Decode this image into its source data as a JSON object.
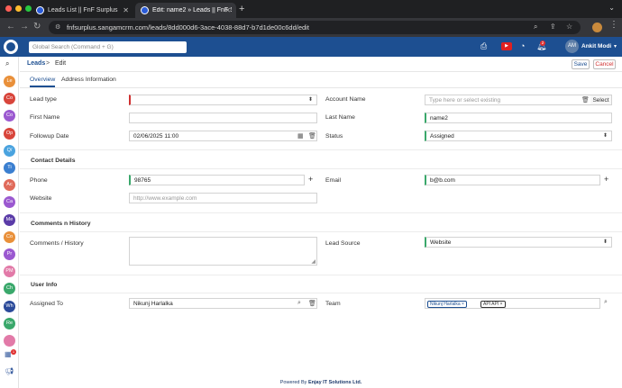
{
  "browser": {
    "tabs": [
      {
        "title": "Leads List || FnF Surplus"
      },
      {
        "title": "Edit: name2 » Leads || FnF Su"
      }
    ],
    "url": "fnfsurplus.sangamcrm.com/leads/8dd000d6-3ace-4038-88d7-b7d1de00c6dd/edit"
  },
  "header": {
    "search_placeholder": "Global Search (Command + G)",
    "notification_count": "2",
    "user_initials": "AM",
    "user_name": "Ankit Modi"
  },
  "rail": {
    "modules": [
      {
        "abbr": "Le",
        "color": "#e9903a"
      },
      {
        "abbr": "Co",
        "color": "#d8453b"
      },
      {
        "abbr": "Co",
        "color": "#9b59d0"
      },
      {
        "abbr": "Op",
        "color": "#d8453b"
      },
      {
        "abbr": "Q/",
        "color": "#4aa3df"
      },
      {
        "abbr": "Ti",
        "color": "#3b7fd0"
      },
      {
        "abbr": "Ac",
        "color": "#e06a5a"
      },
      {
        "abbr": "Ca",
        "color": "#9b59d0"
      },
      {
        "abbr": "Me",
        "color": "#5b3ca8"
      },
      {
        "abbr": "Co",
        "color": "#e9903a"
      },
      {
        "abbr": "Pr",
        "color": "#9b59d0"
      },
      {
        "abbr": "PM",
        "color": "#e27aa8"
      },
      {
        "abbr": "Ch",
        "color": "#3aa86b"
      },
      {
        "abbr": "Wh",
        "color": "#2b4a9a"
      },
      {
        "abbr": "Re",
        "color": "#3aa86b"
      },
      {
        "abbr": "",
        "color": "#e27aa8"
      }
    ],
    "bottom_badge": "1"
  },
  "breadcrumb": {
    "module": "Leads",
    "separator": ">",
    "page": "Edit"
  },
  "actions": {
    "save": "Save",
    "cancel": "Cancel"
  },
  "tabs": [
    {
      "label": "Overview",
      "active": true
    },
    {
      "label": "Address Information",
      "active": false
    }
  ],
  "form": {
    "lead_type": {
      "label": "Lead type",
      "value": ""
    },
    "account_name": {
      "label": "Account Name",
      "placeholder": "Type here or select existing",
      "select": "Select"
    },
    "first_name": {
      "label": "First Name",
      "value": ""
    },
    "last_name": {
      "label": "Last Name",
      "value": "name2"
    },
    "followup_date": {
      "label": "Followup Date",
      "value": "02/06/2025 11:00"
    },
    "status": {
      "label": "Status",
      "value": "Assigned"
    },
    "contact_section": "Contact Details",
    "phone": {
      "label": "Phone",
      "value": "98765"
    },
    "email": {
      "label": "Email",
      "value": "b@b.com"
    },
    "website": {
      "label": "Website",
      "placeholder": "http://www.example.com"
    },
    "comments_section": "Comments n History",
    "comments": {
      "label": "Comments / History",
      "value": ""
    },
    "lead_source": {
      "label": "Lead Source",
      "value": "Website"
    },
    "user_section": "User Info",
    "assigned_to": {
      "label": "Assigned To",
      "value": "Nikunj Harlalka"
    },
    "team": {
      "label": "Team",
      "tags": [
        "Nikunj Harlalka",
        "API API"
      ]
    }
  },
  "footer": {
    "prefix": "Powered By",
    "company": "Enjay IT Solutions Ltd."
  }
}
